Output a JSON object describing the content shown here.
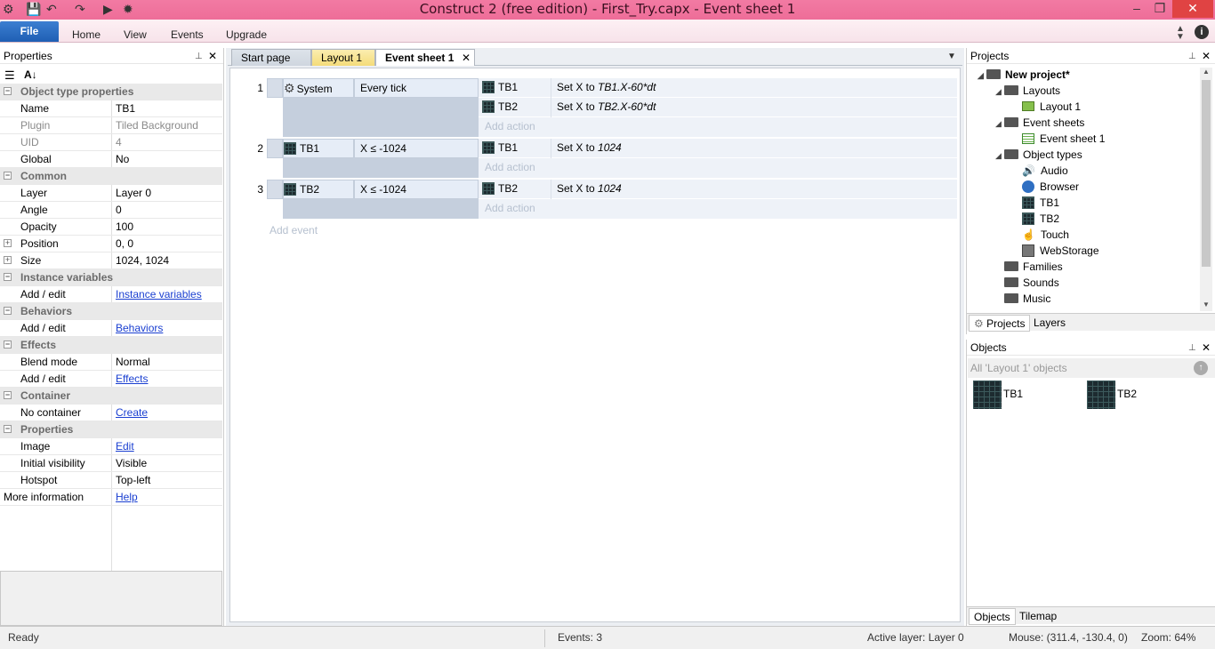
{
  "window": {
    "title": "Construct 2  (free edition) - First_Try.capx - Event sheet 1"
  },
  "ribbon": {
    "file": "File",
    "tabs": [
      "Home",
      "View",
      "Events",
      "Upgrade"
    ]
  },
  "properties": {
    "title": "Properties",
    "rows": [
      {
        "cat": true,
        "label": "Object type properties"
      },
      {
        "label": "Name",
        "value": "TB1"
      },
      {
        "label": "Plugin",
        "value": "Tiled Background",
        "muted": true
      },
      {
        "label": "UID",
        "value": "4",
        "muted": true
      },
      {
        "label": "Global",
        "value": "No"
      },
      {
        "cat": true,
        "label": "Common"
      },
      {
        "label": "Layer",
        "value": "Layer 0"
      },
      {
        "label": "Angle",
        "value": "0"
      },
      {
        "label": "Opacity",
        "value": "100"
      },
      {
        "label": "Position",
        "value": "0, 0",
        "expand": true
      },
      {
        "label": "Size",
        "value": "1024, 1024",
        "expand": true
      },
      {
        "cat": true,
        "label": "Instance variables"
      },
      {
        "label": "Add / edit",
        "value": "Instance variables",
        "link": true
      },
      {
        "cat": true,
        "label": "Behaviors"
      },
      {
        "label": "Add / edit",
        "value": "Behaviors",
        "link": true
      },
      {
        "cat": true,
        "label": "Effects"
      },
      {
        "label": "Blend mode",
        "value": "Normal"
      },
      {
        "label": "Add / edit",
        "value": "Effects",
        "link": true
      },
      {
        "cat": true,
        "label": "Container"
      },
      {
        "label": "No container",
        "value": "Create",
        "link": true
      },
      {
        "cat": true,
        "label": "Properties"
      },
      {
        "label": "Image",
        "value": "Edit",
        "link": true
      },
      {
        "label": "Initial visibility",
        "value": "Visible"
      },
      {
        "label": "Hotspot",
        "value": "Top-left"
      },
      {
        "label": "More information",
        "value": "Help",
        "link": true,
        "outer": true
      }
    ]
  },
  "editor_tabs": [
    "Start page",
    "Layout 1",
    "Event sheet 1"
  ],
  "events": [
    {
      "num": "1",
      "obj": "System",
      "cond": "Every tick",
      "actions": [
        {
          "obj": "TB1",
          "text": "Set X to ",
          "expr": "TB1.X-60*dt"
        },
        {
          "obj": "TB2",
          "text": "Set X to ",
          "expr": "TB2.X-60*dt"
        }
      ]
    },
    {
      "num": "2",
      "obj": "TB1",
      "cond": "X ≤ -1024",
      "actions": [
        {
          "obj": "TB1",
          "text": "Set X to ",
          "expr": "1024"
        }
      ]
    },
    {
      "num": "3",
      "obj": "TB2",
      "cond": "X ≤ -1024",
      "actions": [
        {
          "obj": "TB2",
          "text": "Set X to ",
          "expr": "1024"
        }
      ]
    }
  ],
  "add_action": "Add action",
  "add_event": "Add event",
  "projects": {
    "title": "Projects",
    "root": "New project*",
    "layouts": "Layouts",
    "layout1": "Layout 1",
    "event_sheets": "Event sheets",
    "event_sheet1": "Event sheet 1",
    "object_types": "Object types",
    "objects": [
      "Audio",
      "Browser",
      "TB1",
      "TB2",
      "Touch",
      "WebStorage"
    ],
    "families": "Families",
    "sounds": "Sounds",
    "music": "Music",
    "tab_projects": "Projects",
    "tab_layers": "Layers"
  },
  "objects_panel": {
    "title": "Objects",
    "filter": "All 'Layout 1' objects",
    "items": [
      "TB1",
      "TB2"
    ],
    "tab_objects": "Objects",
    "tab_tilemap": "Tilemap"
  },
  "status": {
    "ready": "Ready",
    "events": "Events: 3",
    "layer": "Active layer: Layer 0",
    "mouse": "Mouse: (311.4, -130.4, 0)",
    "zoom": "Zoom: 64%"
  },
  "colors": {
    "titlebar": "#f07aa2",
    "accent": "#2a6bc4",
    "close": "#e04343"
  }
}
